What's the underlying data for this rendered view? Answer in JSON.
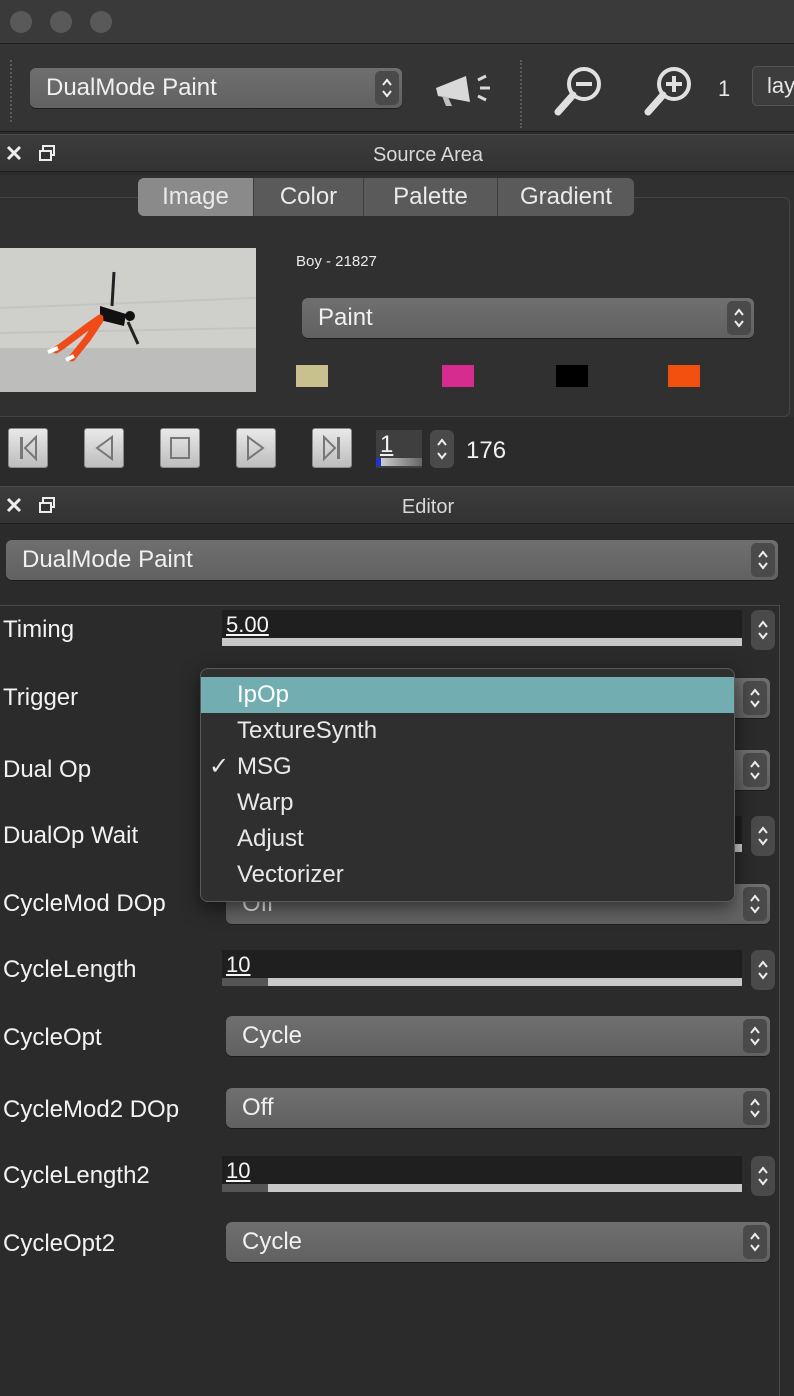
{
  "toolbar": {
    "mode_select": "DualMode Paint",
    "zoom_level": "1",
    "layer_label": "lay"
  },
  "source_area": {
    "title": "Source Area",
    "tabs": [
      {
        "label": "Image",
        "active": true
      },
      {
        "label": "Color",
        "active": false
      },
      {
        "label": "Palette",
        "active": false
      },
      {
        "label": "Gradient",
        "active": false
      }
    ],
    "image_name": "Boy - 21827",
    "paint_select": "Paint",
    "swatches": [
      "#c8c18e",
      "#d62b8f",
      "#000000",
      "#f2500f"
    ],
    "frame_current": "1",
    "frame_total": "176"
  },
  "editor": {
    "title": "Editor",
    "preset_select": "DualMode Paint",
    "rows": {
      "timing": {
        "label": "Timing",
        "value": "5.00"
      },
      "trigger": {
        "label": "Trigger"
      },
      "dual_op": {
        "label": "Dual Op"
      },
      "dualop_wait": {
        "label": "DualOp Wait"
      },
      "cyclemod_dop": {
        "label": "CycleMod DOp",
        "value": "Off"
      },
      "cyclelength": {
        "label": "CycleLength",
        "value": "10"
      },
      "cycleopt": {
        "label": "CycleOpt",
        "value": "Cycle"
      },
      "cyclemod2_dop": {
        "label": "CycleMod2 DOp",
        "value": "Off"
      },
      "cyclelength2": {
        "label": "CycleLength2",
        "value": "10"
      },
      "cycleopt2": {
        "label": "CycleOpt2",
        "value": "Cycle"
      }
    },
    "popup": {
      "items": [
        "IpOp",
        "TextureSynth",
        "MSG",
        "Warp",
        "Adjust",
        "Vectorizer"
      ],
      "highlighted": "IpOp",
      "checked": "MSG",
      "check_glyph": "✓"
    }
  },
  "colors": {
    "highlight": "#72aeb1",
    "panel": "#2b2b2b"
  }
}
